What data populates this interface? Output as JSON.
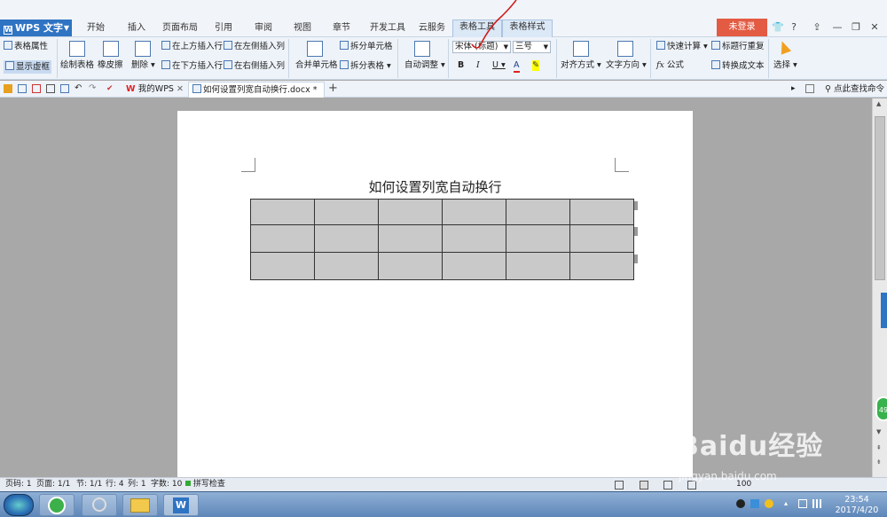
{
  "app": {
    "menu_label": "WPS 文字",
    "login_label": "未登录",
    "help_label": "?"
  },
  "ribbon_tabs": [
    "开始",
    "插入",
    "页面布局",
    "引用",
    "审阅",
    "视图",
    "章节",
    "开发工具",
    "云服务",
    "表格工具",
    "表格样式"
  ],
  "active_tab": "表格工具",
  "ribbon": {
    "table_props": "表格属性",
    "show_gridlines": "显示虚框",
    "draw_table": "绘制表格",
    "eraser": "橡皮擦",
    "delete": "删除",
    "insert_above": "在上方插入行",
    "insert_below": "在下方插入行",
    "insert_left": "在左侧插入列",
    "insert_right": "在右侧插入列",
    "merge_cells": "合并单元格",
    "split_cells": "拆分单元格",
    "split_table": "拆分表格",
    "autofit": "自动调整",
    "font_name": "宋体 (标题)",
    "font_size": "三号",
    "bold": "B",
    "italic": "I",
    "underline": "U",
    "font_color": "A",
    "align": "对齐方式",
    "text_direction": "文字方向",
    "quick_calc": "快速计算",
    "formula": "公式",
    "repeat_header": "标题行重复",
    "to_text": "转换成文本",
    "select": "选择"
  },
  "doc_tabs": {
    "home": "我的WPS",
    "current": "如何设置列宽自动换行.docx *",
    "search": "点此查找命令"
  },
  "document": {
    "title": "如何设置列宽自动换行",
    "table": {
      "rows": 3,
      "cols": 6
    }
  },
  "status": {
    "page_num": "页码: 1",
    "pages": "页面: 1/1",
    "section": "节: 1/1",
    "row": "行: 4",
    "col": "列: 1",
    "words": "字数: 10",
    "spell": "拼写检查",
    "zoom": "100"
  },
  "taskbar": {
    "time": "23:54",
    "date": "2017/4/20"
  },
  "side_widget": "49",
  "watermark": {
    "brand": "Baidu经验",
    "url": "jingyan.baidu.com"
  },
  "colors": {
    "wps_blue": "#2f73c3",
    "login_red": "#e35b43",
    "table_fill": "#c9c9c9"
  }
}
